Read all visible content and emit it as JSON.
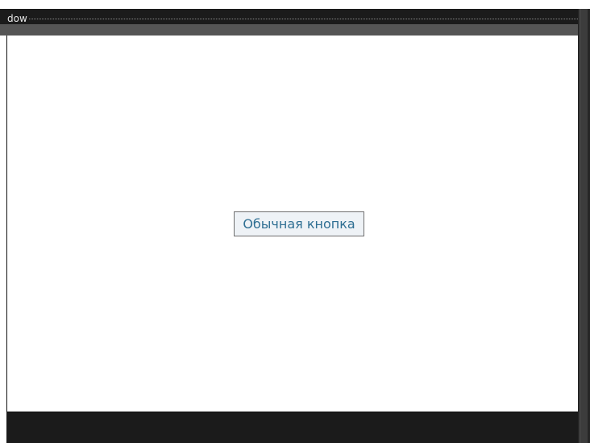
{
  "window": {
    "title": "dow"
  },
  "main": {
    "button_label": "Обычная кнопка"
  }
}
